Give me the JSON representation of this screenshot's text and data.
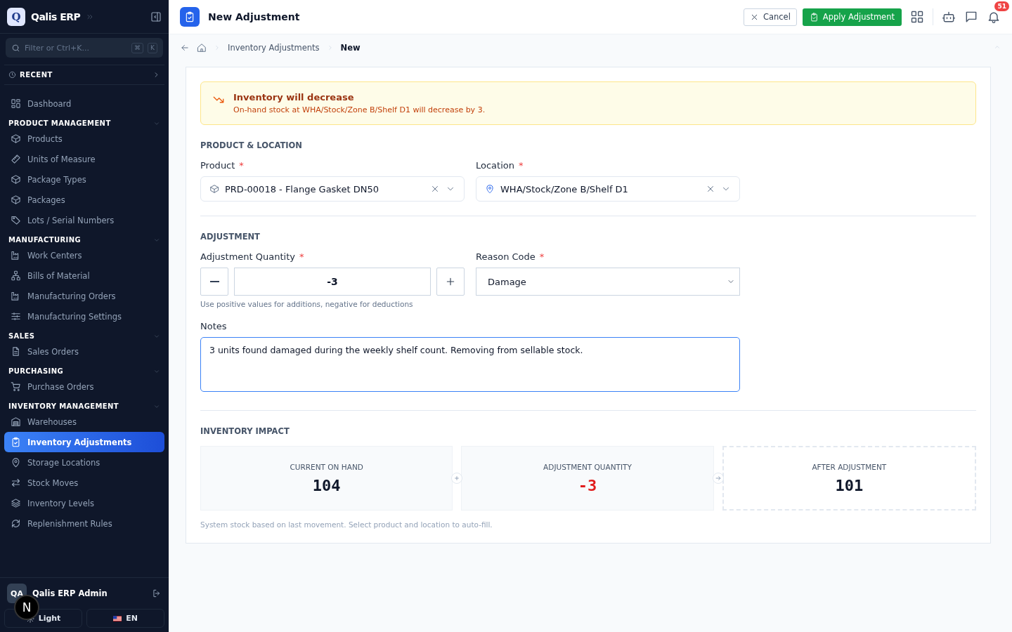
{
  "sidebar": {
    "brand_initial": "Q",
    "brand": "Qalis ERP",
    "search_placeholder": "Filter or Ctrl+K...",
    "shortcut": [
      "⌘",
      "K"
    ],
    "recent": "RECENT",
    "sections": [
      {
        "items": [
          {
            "label": "Dashboard",
            "selected": false
          }
        ]
      },
      {
        "title": "PRODUCT MANAGEMENT",
        "items": [
          {
            "label": "Products",
            "selected": false
          },
          {
            "label": "Units of Measure",
            "selected": false
          },
          {
            "label": "Package Types",
            "selected": false
          },
          {
            "label": "Packages",
            "selected": false
          },
          {
            "label": "Lots / Serial Numbers",
            "selected": false
          }
        ]
      },
      {
        "title": "MANUFACTURING",
        "items": [
          {
            "label": "Work Centers",
            "selected": false
          },
          {
            "label": "Bills of Material",
            "selected": false
          },
          {
            "label": "Manufacturing Orders",
            "selected": false
          },
          {
            "label": "Manufacturing Settings",
            "selected": false
          }
        ]
      },
      {
        "title": "SALES",
        "items": [
          {
            "label": "Sales Orders",
            "selected": false
          }
        ]
      },
      {
        "title": "PURCHASING",
        "items": [
          {
            "label": "Purchase Orders",
            "selected": false
          }
        ]
      },
      {
        "title": "INVENTORY MANAGEMENT",
        "items": [
          {
            "label": "Warehouses",
            "selected": false
          },
          {
            "label": "Inventory Adjustments",
            "selected": true
          },
          {
            "label": "Storage Locations",
            "selected": false
          },
          {
            "label": "Stock Moves",
            "selected": false
          },
          {
            "label": "Inventory Levels",
            "selected": false
          },
          {
            "label": "Replenishment Rules",
            "selected": false
          }
        ]
      }
    ],
    "user": {
      "initials": "QA",
      "name": "Qalis ERP Admin"
    },
    "dev_badge": "N",
    "theme": "Light",
    "language": "EN"
  },
  "header": {
    "title": "New Adjustment",
    "cancel": "Cancel",
    "apply": "Apply Adjustment",
    "notifications": "51"
  },
  "breadcrumb": [
    "Inventory Adjustments",
    "New"
  ],
  "alert": {
    "title": "Inventory will decrease",
    "message": "On-hand stock at WHA/Stock/Zone B/Shelf D1 will decrease by 3."
  },
  "product_location": {
    "heading": "PRODUCT & LOCATION",
    "product": {
      "label": "Product",
      "required_mark": "*",
      "value": "PRD-00018 - Flange Gasket DN50"
    },
    "location": {
      "label": "Location",
      "required_mark": "*",
      "value": "WHA/Stock/Zone B/Shelf D1"
    }
  },
  "adjustment": {
    "heading": "ADJUSTMENT",
    "quantity": {
      "label": "Adjustment Quantity",
      "required_mark": "*",
      "value": "-3",
      "hint": "Use positive values for additions, negative for deductions"
    },
    "reason": {
      "label": "Reason Code",
      "required_mark": "*",
      "value": "Damage"
    },
    "notes": {
      "label": "Notes",
      "value": "3 units found damaged during the weekly shelf count. Removing from sellable stock."
    }
  },
  "impact": {
    "heading": "INVENTORY IMPACT",
    "cards": [
      {
        "label": "CURRENT ON HAND",
        "value": "104",
        "kind": "plain"
      },
      {
        "label": "ADJUSTMENT QUANTITY",
        "value": "-3",
        "kind": "negative"
      },
      {
        "label": "AFTER ADJUSTMENT",
        "value": "101",
        "kind": "result"
      }
    ],
    "note": "System stock based on last movement. Select product and location to auto-fill."
  }
}
